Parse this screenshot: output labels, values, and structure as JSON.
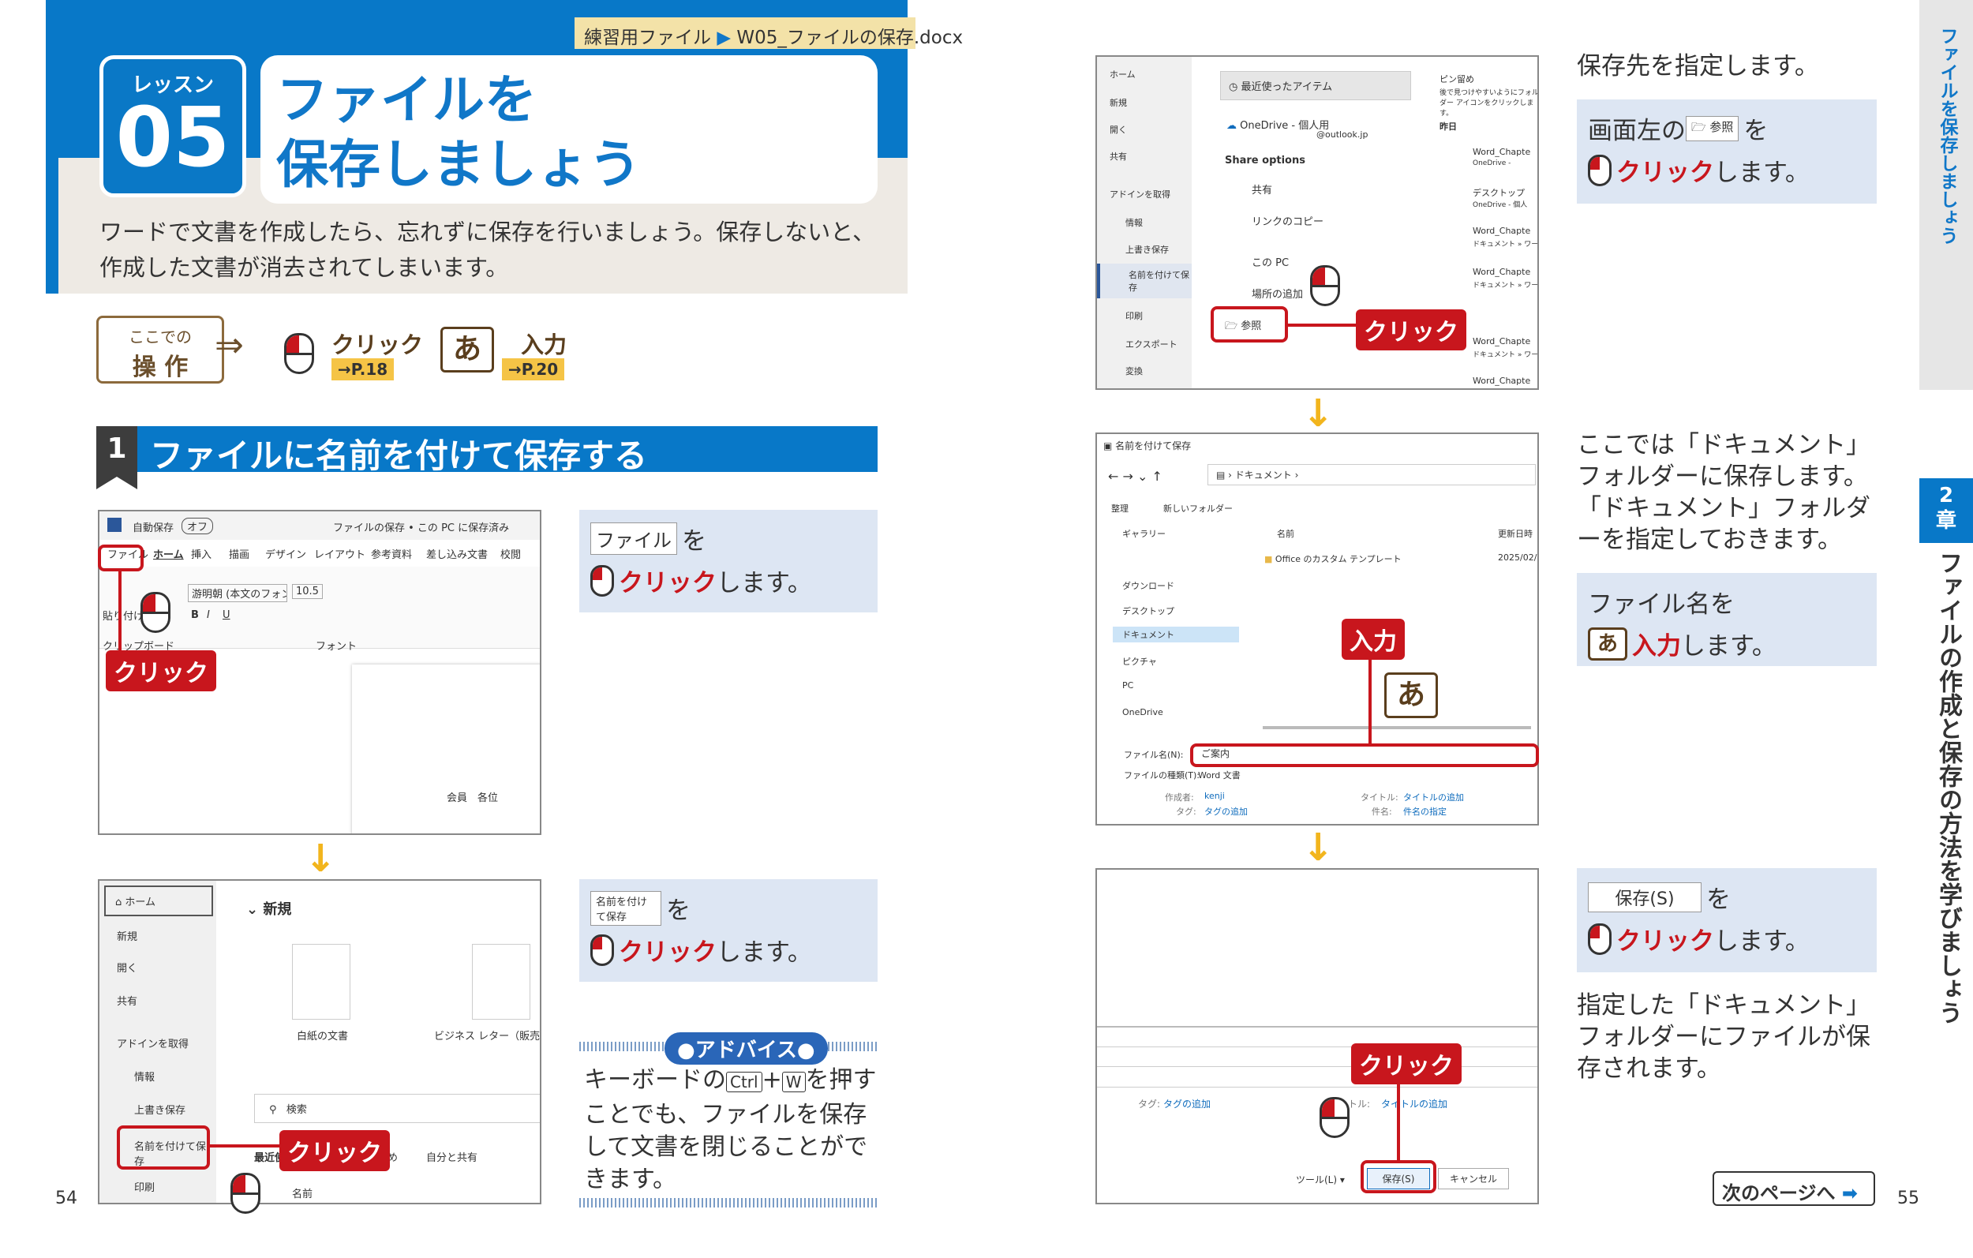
{
  "header": {
    "practice_file_label": "練習用ファイル",
    "practice_file_name": "W05_ファイルの保存.docx",
    "lesson_label": "レッスン",
    "lesson_number": "05",
    "title_line1": "ファイルを",
    "title_line2": "保存しましょう",
    "intro_line1": "ワードで文書を作成したら、忘れずに保存を行いましょう。保存しないと、",
    "intro_line2": "作成した文書が消去されてしまいます。"
  },
  "ops": {
    "box_small": "ここでの",
    "box_big": "操 作",
    "click_label": "クリック",
    "click_ref": "→P.18",
    "ime_glyph": "あ",
    "input_label": "入力",
    "input_ref": "→P.20"
  },
  "section": {
    "number": "1",
    "title": "ファイルに名前を付けて保存する"
  },
  "shot1": {
    "autosave": "自動保存",
    "toggle": "オフ",
    "doc_title": "ファイルの保存 • この PC に保存済み",
    "tabs": [
      "ファイル",
      "ホーム",
      "挿入",
      "描画",
      "デザイン",
      "レイアウト",
      "参考資料",
      "差し込み文書",
      "校閲"
    ],
    "font_name": "游明朝 (本文のフォント)",
    "font_size": "10.5",
    "group_label": "フォント",
    "clipboard": "クリップボード",
    "paste": "貼り付け",
    "doc_text": "会員　各位",
    "click_label": "クリック"
  },
  "shot2": {
    "nav": [
      "ホーム",
      "新規",
      "開く",
      "共有",
      "アドインを取得",
      "情報",
      "上書き保存",
      "名前を付けて保存",
      "印刷"
    ],
    "new_heading": "新規",
    "blank_doc": "白紙の文書",
    "business_letter": "ビジネス レター（販売用ス",
    "search": "検索",
    "tab_recent": "最近使",
    "tab_pinned": "留め",
    "tab_shared": "自分と共有",
    "col_name": "名前",
    "click_label": "クリック"
  },
  "shot3": {
    "nav": [
      "ホーム",
      "新規",
      "開く",
      "共有",
      "アドインを取得",
      "情報",
      "上書き保存",
      "名前を付けて保存",
      "印刷",
      "エクスポート",
      "変換"
    ],
    "recent": "最近使ったアイテム",
    "onedrive": "OneDrive - 個人用",
    "onedrive_sub": "@outlook.jp",
    "share_options": "Share options",
    "share": "共有",
    "link_copy": "リンクのコピー",
    "this_pc": "この PC",
    "add_place": "場所の追加",
    "browse": "参照",
    "pinned": "ピン留め",
    "pinned_desc": "後で見つけやすいようにフォルダー アイコンをクリックします。",
    "yesterday": "昨日",
    "files": [
      {
        "name": "Word_Chapte",
        "sub": "OneDrive -"
      },
      {
        "name": "デスクトップ",
        "sub": "OneDrive - 個人"
      },
      {
        "name": "Word_Chapte",
        "sub": "ドキュメント » ワー"
      },
      {
        "name": "Word_Chapte",
        "sub": "ドキュメント » ワー"
      },
      {
        "name": "Word_Chapte",
        "sub": "ドキュメント » ワー"
      },
      {
        "name": "Word_Chapte",
        "sub": ""
      }
    ],
    "click_label": "クリック"
  },
  "shot4": {
    "title": "名前を付けて保存",
    "path": "ドキュメント",
    "organize": "整理",
    "new_folder": "新しいフォルダー",
    "col_name": "名前",
    "col_date": "更新日時",
    "nav": [
      "ギャラリー",
      "ダウンロード",
      "デスクトップ",
      "ドキュメント",
      "ピクチャ",
      "PC",
      "OneDrive"
    ],
    "folder_item": "Office のカスタム テンプレート",
    "folder_date": "2025/02/",
    "filename_label": "ファイル名(N):",
    "filename_value": "ご案内",
    "filetype_label": "ファイルの種類(T):",
    "filetype_value": "Word 文書",
    "author_label": "作成者:",
    "author_value": "kenji",
    "tag_label": "タグ:",
    "tag_value": "タグの追加",
    "title_label": "タイトル:",
    "title_value": "タイトルの追加",
    "subject_label": "件名:",
    "subject_value": "件名の指定",
    "input_label": "入力",
    "ime_glyph": "あ"
  },
  "shot5": {
    "tag_label": "タグ:",
    "tag_value": "タグの追加",
    "title_label": "トル:",
    "title_value": "タイトルの追加",
    "tool": "ツール(L)",
    "save": "保存(S)",
    "cancel": "キャンセル",
    "click_label": "クリック"
  },
  "instructions": {
    "step1_button": "ファイル",
    "wo": "を",
    "click": "クリック",
    "shimasu": "します。",
    "step2_button": "名前を付けて保存",
    "step3_intro": "保存先を指定します。",
    "step3_lead": "画面左の",
    "step3_button": "参照",
    "step4_text": "ここでは「ドキュメント」フォルダーに保存します。「ドキュメント」フォルダーを指定しておきます。",
    "step5_line1": "ファイル名を",
    "step5_input": "入力",
    "step6_button": "保存(S)",
    "step6_after": "指定した「ドキュメント」フォルダーにファイルが保存されます。"
  },
  "advice": {
    "label": "アドバイス",
    "t1": "キーボードの",
    "key1": "Ctrl",
    "plus": "+",
    "key2": "W",
    "t2": "を押す",
    "rest": "ことでも、ファイルを保存して文書を閉じることができます。"
  },
  "side": {
    "top_tab": "ファイルを保存しましょう",
    "chapter_num": "2",
    "chapter_suffix": "章",
    "chapter_title": "ファイルの作成と保存の方法を学びましょう"
  },
  "footer": {
    "page_left": "54",
    "page_right": "55",
    "next_page": "次のページへ"
  },
  "colors": {
    "blue": "#0878c8",
    "red": "#c8161d",
    "yellow": "#f2b51d",
    "instr_bg": "#dde6f3"
  }
}
